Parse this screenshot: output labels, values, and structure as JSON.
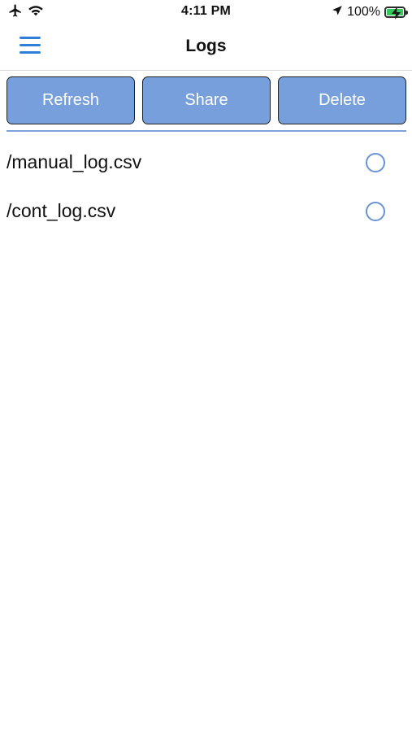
{
  "status_bar": {
    "time": "4:11 PM",
    "battery_percent": "100%",
    "icons": [
      "airplane-icon",
      "wifi-icon",
      "location-arrow-icon",
      "battery-charging-icon"
    ],
    "battery_color": "#34c759"
  },
  "nav": {
    "title": "Logs",
    "menu_icon": "hamburger-menu-icon",
    "accent_color": "#2f7fd8"
  },
  "actions": {
    "refresh_label": "Refresh",
    "share_label": "Share",
    "delete_label": "Delete",
    "button_color": "#769fdb"
  },
  "files": [
    {
      "name": "/manual_log.csv",
      "selected": false
    },
    {
      "name": "/cont_log.csv",
      "selected": false
    }
  ]
}
